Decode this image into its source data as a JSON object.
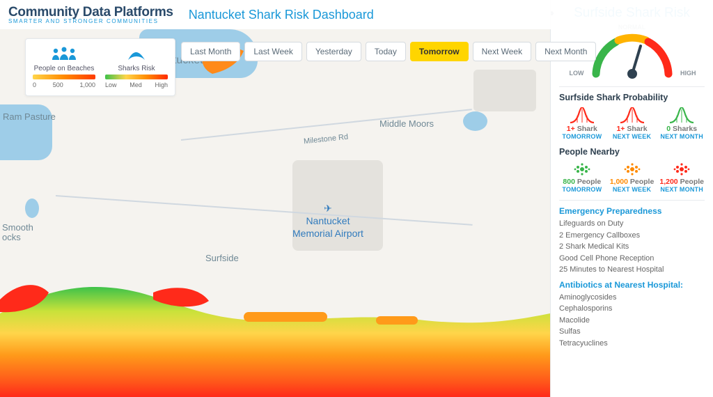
{
  "header": {
    "logo_main": "Community Data Platforms",
    "logo_sub": "SMARTER AND STRONGER COMMUNITIES",
    "title": "Nantucket Shark Risk Dashboard"
  },
  "time_filters": [
    "Last Month",
    "Last Week",
    "Yesterday",
    "Today",
    "Tomorrow",
    "Next Week",
    "Next Month"
  ],
  "time_active": "Tomorrow",
  "map_labels": {
    "nantucket": "ntucket",
    "rams": "Ram Pasture",
    "moors": "Middle Moors",
    "milestone": "Milestone Rd",
    "airport_l1": "Nantucket",
    "airport_l2": "Memorial Airport",
    "surfside": "Surfside",
    "smooth_l1": "Smooth",
    "smooth_l2": "ocks"
  },
  "legend": {
    "people_title": "People on Beaches",
    "people_ticks": [
      "0",
      "500",
      "1,000"
    ],
    "shark_title": "Sharks Risk",
    "shark_ticks": [
      "Low",
      "Med",
      "High"
    ]
  },
  "panel": {
    "title": "Surfside Shark Risk",
    "gauge": {
      "low": "LOW",
      "normal": "NORMAL",
      "high": "HIGH"
    },
    "prob_title": "Surfside Shark Probability",
    "prob": [
      {
        "count": "1+",
        "unit": "Shark",
        "when": "TOMORROW",
        "color": "c-red"
      },
      {
        "count": "1+",
        "unit": "Shark",
        "when": "NEXT WEEK",
        "color": "c-red"
      },
      {
        "count": "0",
        "unit": "Sharks",
        "when": "NEXT MONTH",
        "color": "c-green"
      }
    ],
    "people_title": "People Nearby",
    "people": [
      {
        "count": "800",
        "unit": "People",
        "when": "TOMORROW",
        "color": "c-green"
      },
      {
        "count": "1,000",
        "unit": "People",
        "when": "NEXT WEEK",
        "color": "c-orange"
      },
      {
        "count": "1,200",
        "unit": "People",
        "when": "NEXT MONTH",
        "color": "c-red"
      }
    ],
    "emergency_title": "Emergency Preparedness",
    "emergency": [
      "Lifeguards on Duty",
      "2 Emergency Callboxes",
      "2 Shark Medical Kits",
      "Good Cell Phone Reception",
      "25 Minutes to Nearest Hospital"
    ],
    "antibiotics_title": "Antibiotics at Nearest Hospital:",
    "antibiotics": [
      "Aminoglycosides",
      "Cephalosporins",
      "Macolide",
      "Sulfas",
      "Tetracyuclines"
    ]
  }
}
